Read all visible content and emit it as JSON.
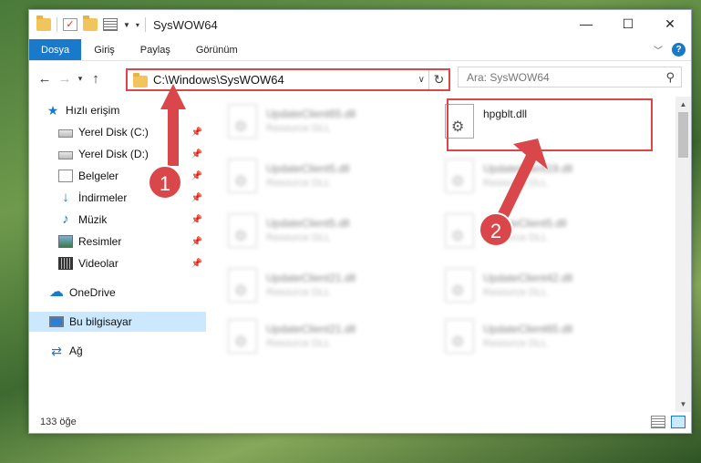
{
  "window": {
    "title": "SysWOW64",
    "controls": {
      "minimize": "—",
      "maximize": "☐",
      "close": "✕"
    }
  },
  "ribbon": {
    "tabs": [
      "Dosya",
      "Giriş",
      "Paylaş",
      "Görünüm"
    ],
    "help": "?"
  },
  "address": {
    "path": "C:\\Windows\\SysWOW64",
    "search_placeholder": "Ara: SysWOW64"
  },
  "sidebar": {
    "items": [
      {
        "label": "Hızlı erişim",
        "icon": "star-icon"
      },
      {
        "label": "Yerel Disk (C:)",
        "icon": "drive-icon",
        "pinned": true
      },
      {
        "label": "Yerel Disk (D:)",
        "icon": "drive-icon",
        "pinned": true
      },
      {
        "label": "Belgeler",
        "icon": "document-icon",
        "pinned": true
      },
      {
        "label": "İndirmeler",
        "icon": "download-icon",
        "pinned": true
      },
      {
        "label": "Müzik",
        "icon": "music-icon",
        "pinned": true
      },
      {
        "label": "Resimler",
        "icon": "pictures-icon",
        "pinned": true
      },
      {
        "label": "Videolar",
        "icon": "videos-icon",
        "pinned": true
      },
      {
        "label": "OneDrive",
        "icon": "cloud-icon"
      },
      {
        "label": "Bu bilgisayar",
        "icon": "computer-icon",
        "selected": true
      },
      {
        "label": "Ağ",
        "icon": "network-icon"
      }
    ]
  },
  "files": [
    {
      "name": "UpdateClient65.dll",
      "type": "Resource DLL"
    },
    {
      "name": "hpgblt.dll",
      "type": ""
    },
    {
      "name": "UpdateClient5.dll",
      "type": "Resource DLL"
    },
    {
      "name": "UpdateClient19.dll",
      "type": "Resource DLL"
    },
    {
      "name": "UpdateClient5.dll",
      "type": "Resource DLL"
    },
    {
      "name": "UpdateClient5.dll",
      "type": "Resource DLL"
    },
    {
      "name": "UpdateClient21.dll",
      "type": "Resource DLL"
    },
    {
      "name": "UpdateClient42.dll",
      "type": "Resource DLL"
    },
    {
      "name": "UpdateClient21.dll",
      "type": "Resource DLL"
    },
    {
      "name": "UpdateClient65.dll",
      "type": "Resource DLL"
    }
  ],
  "status": {
    "item_count": "133 öğe"
  },
  "annotations": {
    "step1": "1",
    "step2": "2",
    "color": "#d9474a"
  }
}
